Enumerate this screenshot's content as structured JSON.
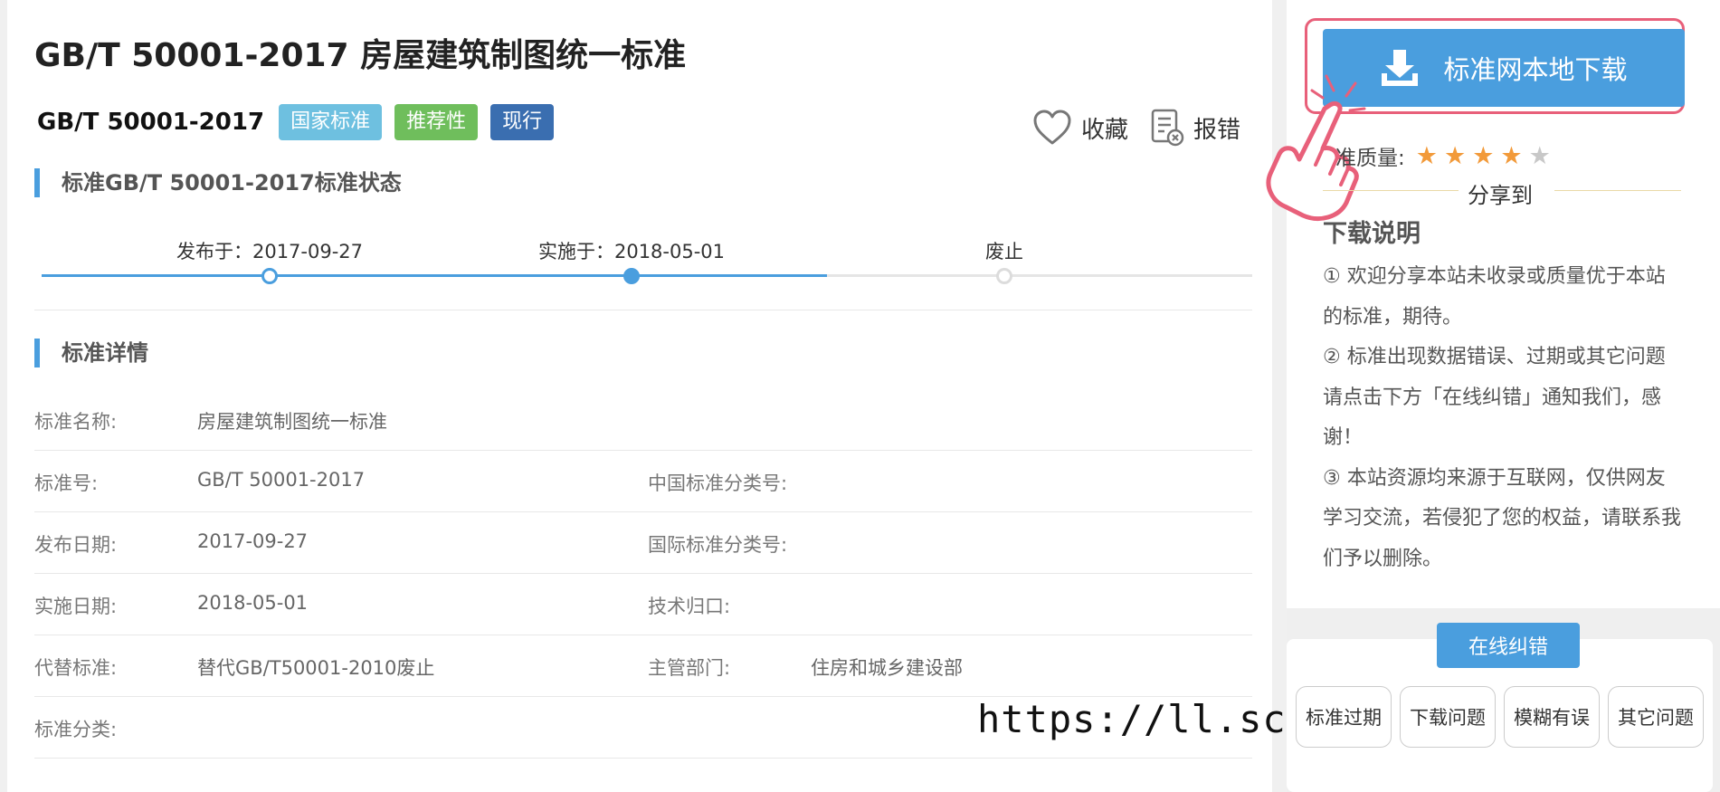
{
  "header": {
    "title": "GB/T 50001-2017 房屋建筑制图统一标准",
    "code": "GB/T 50001-2017",
    "tags": [
      {
        "label": "国家标准",
        "color": "#6ec0e0"
      },
      {
        "label": "推荐性",
        "color": "#6fbe5c"
      },
      {
        "label": "现行",
        "color": "#3a6eb0"
      }
    ],
    "actions": {
      "favorite": "收藏",
      "report": "报错"
    }
  },
  "status_section": {
    "heading": "标准GB/T 50001-2017标准状态",
    "timeline": [
      {
        "label": "发布于：2017-09-27",
        "state": "done"
      },
      {
        "label": "实施于：2018-05-01",
        "state": "current"
      },
      {
        "label": "废止",
        "state": "pending"
      }
    ]
  },
  "details_section": {
    "heading": "标准详情",
    "rows": [
      {
        "label": "标准名称:",
        "value": "房屋建筑制图统一标准",
        "label2": "",
        "value2": ""
      },
      {
        "label": "标准号:",
        "value": "GB/T 50001-2017",
        "label2": "中国标准分类号:",
        "value2": ""
      },
      {
        "label": "发布日期:",
        "value": "2017-09-27",
        "label2": "国际标准分类号:",
        "value2": ""
      },
      {
        "label": "实施日期:",
        "value": "2018-05-01",
        "label2": "技术归口:",
        "value2": ""
      },
      {
        "label": "代替标准:",
        "value": "替代GB/T50001-2010废止",
        "label2": "主管部门:",
        "value2": "住房和城乡建设部"
      },
      {
        "label": "标准分类:",
        "value": "",
        "label2": "",
        "value2": ""
      }
    ]
  },
  "watermark": "https://ll.sc.cn",
  "sidebar": {
    "download_label": "标准网本地下载",
    "quality_label": "准质量:",
    "rating": 4,
    "rating_max": 5,
    "share_label": "分享到",
    "notes_heading": "下载说明",
    "notes": [
      "① 欢迎分享本站未收录或质量优于本站的标准，期待。",
      "② 标准出现数据错误、过期或其它问题请点击下方「在线纠错」通知我们，感谢！",
      "③ 本站资源均来源于互联网，仅供网友学习交流，若侵犯了您的权益，请联系我们予以删除。"
    ],
    "fix_label": "在线纠错",
    "issue_buttons": [
      "标准过期",
      "下载问题",
      "模糊有误",
      "其它问题"
    ]
  },
  "colors": {
    "accent": "#4a9ede",
    "star_on": "#f29a3a",
    "star_off": "#c8c8c8",
    "highlight_frame": "#e8607a"
  }
}
